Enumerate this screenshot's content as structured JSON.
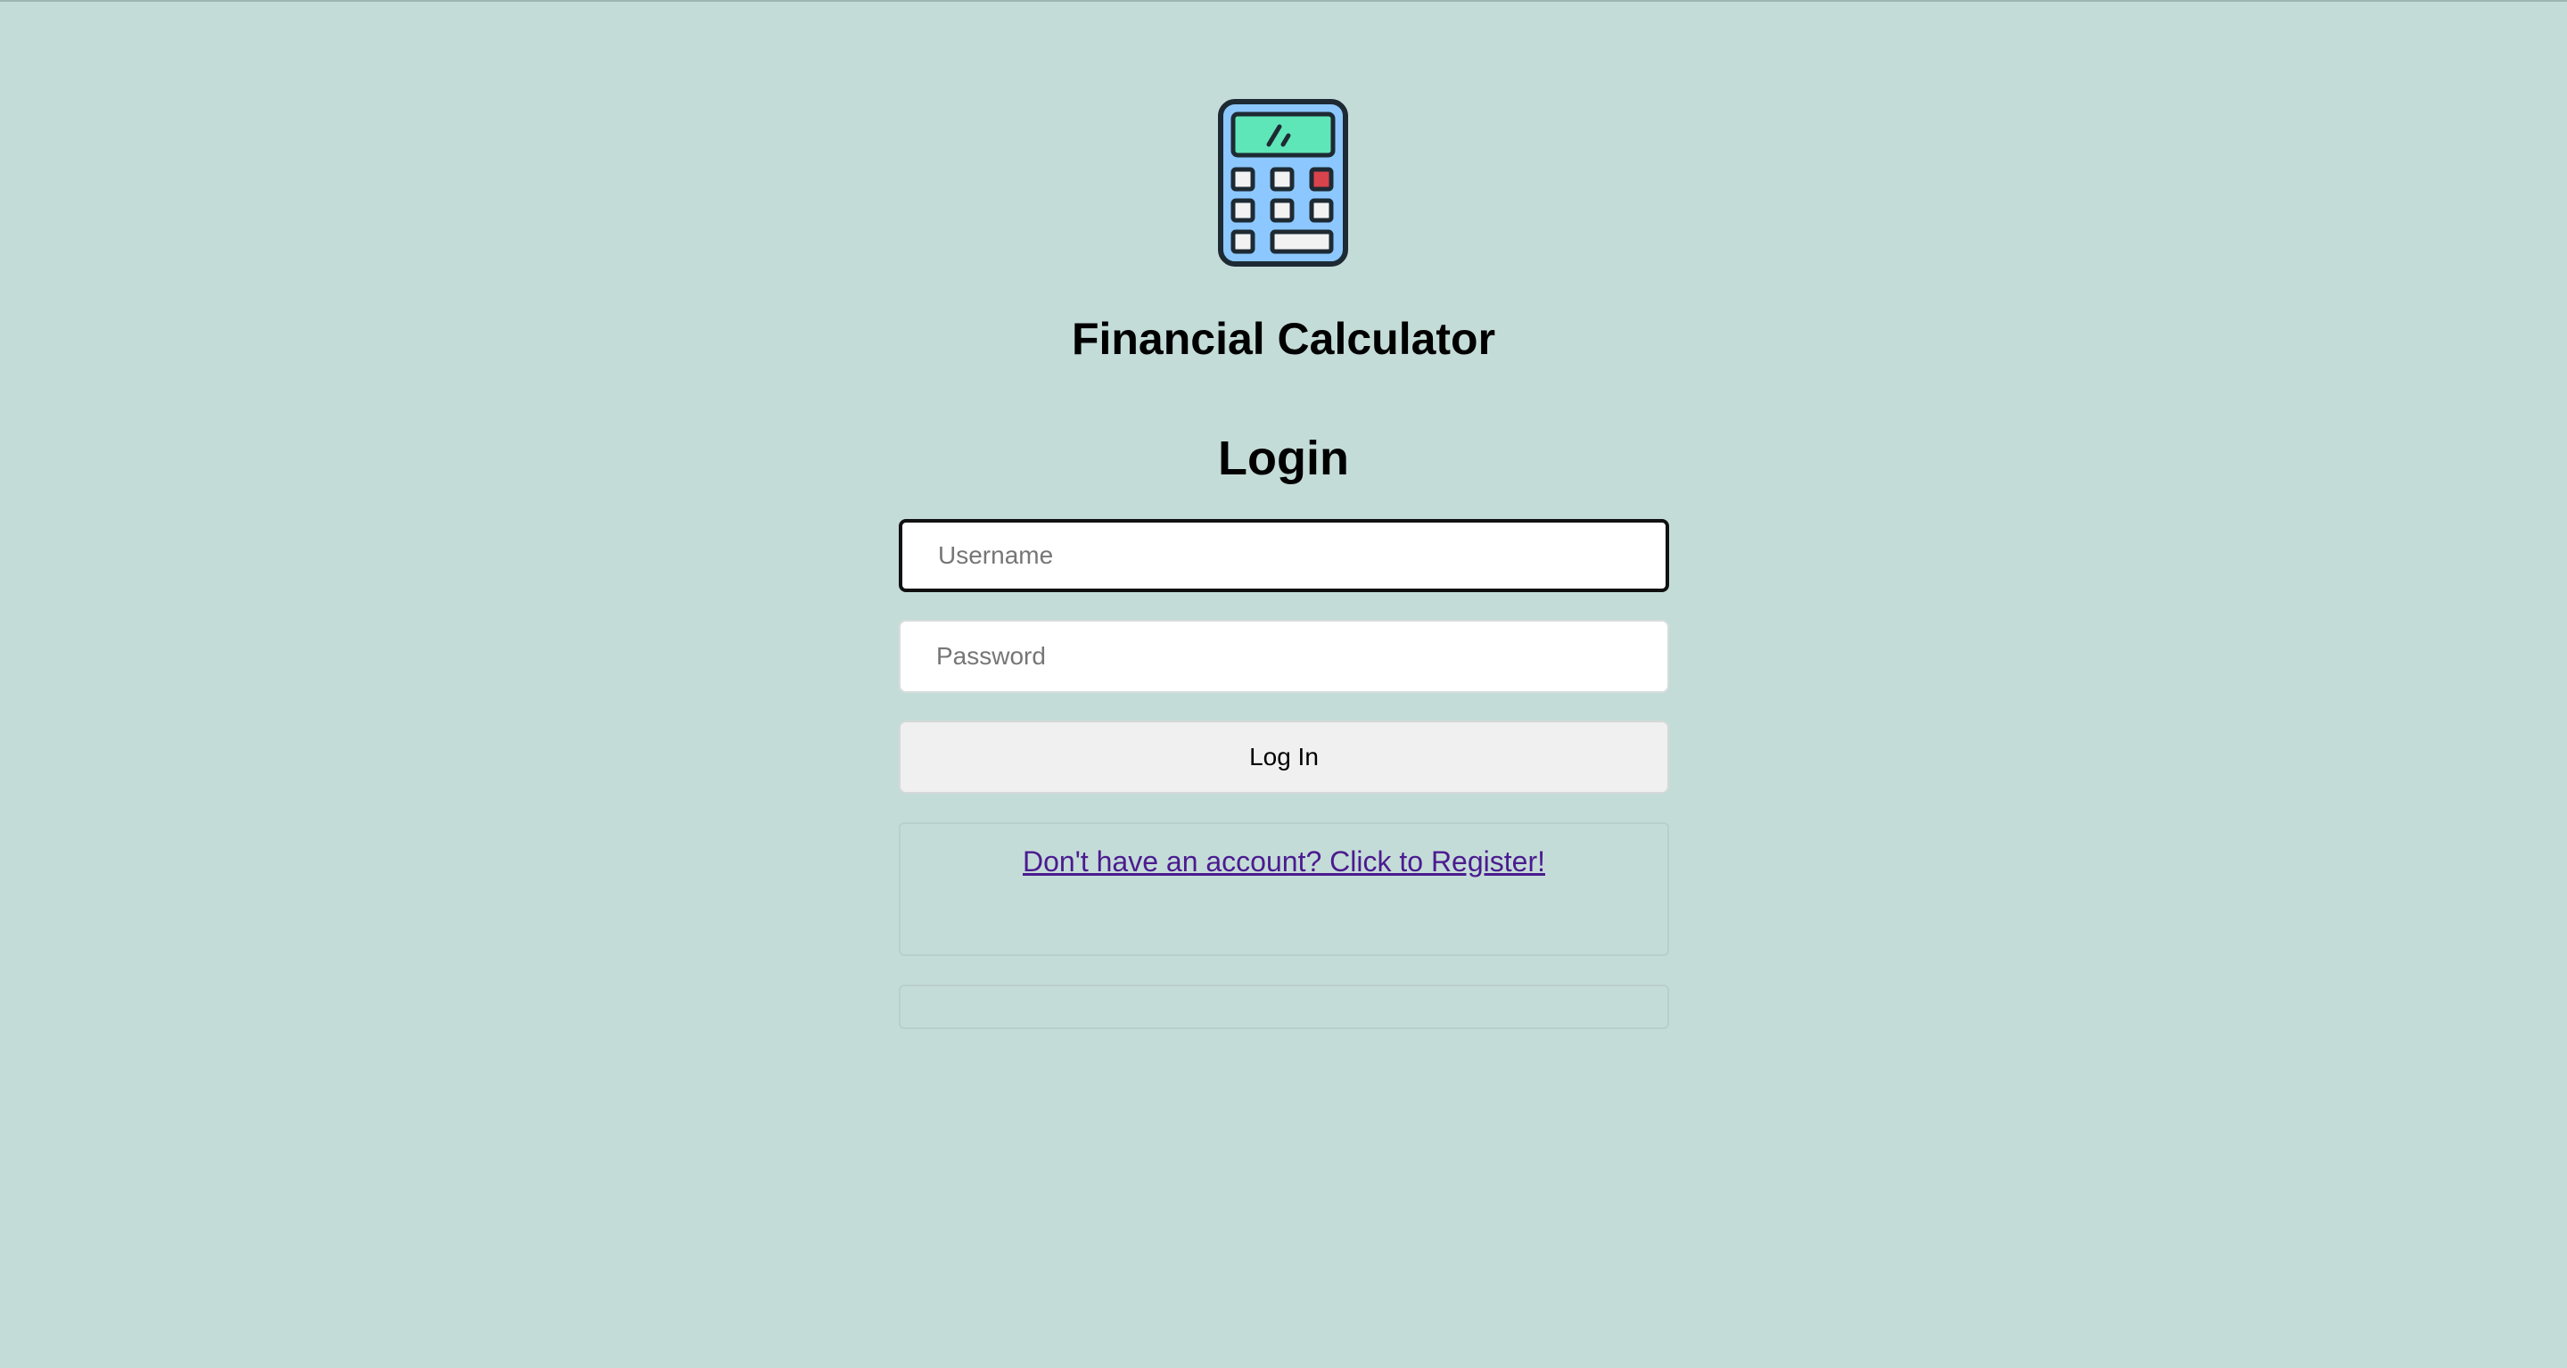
{
  "app": {
    "title": "Financial Calculator",
    "logo_icon": "calculator-icon"
  },
  "login": {
    "heading": "Login",
    "username_placeholder": "Username",
    "password_placeholder": "Password",
    "submit_label": "Log In",
    "register_link": "Don't have an account? Click to Register!"
  },
  "colors": {
    "background": "#c4dcd8",
    "logo_body": "#8cc8ff",
    "logo_screen": "#5ee6b8",
    "logo_accent_key": "#d9434c",
    "link": "#4b1b8f"
  }
}
